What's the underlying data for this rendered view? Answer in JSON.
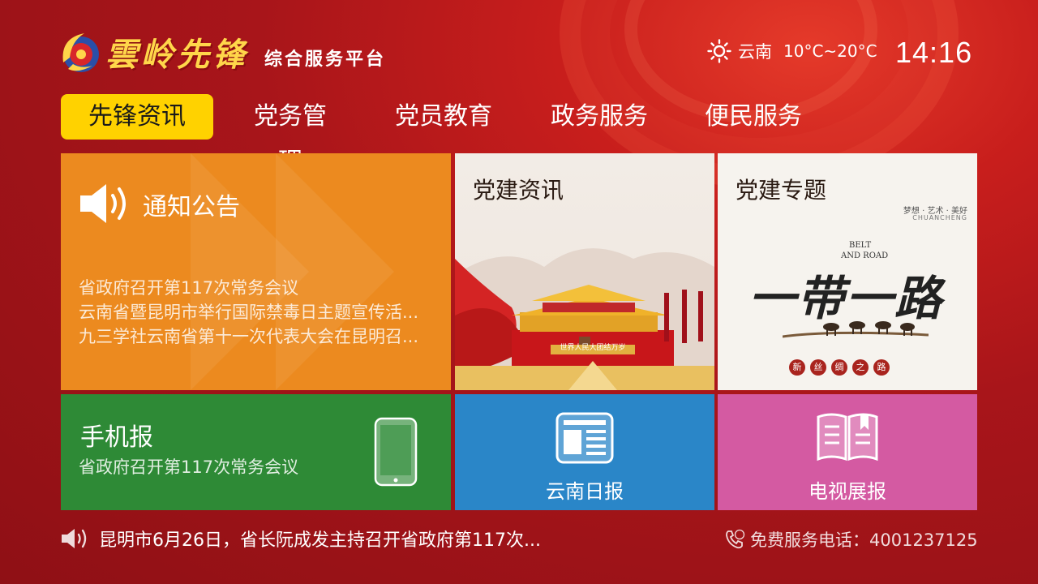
{
  "header": {
    "logo_title": "雲岭先锋",
    "logo_subtitle": "综合服务平台",
    "weather_icon": "sun-icon",
    "location": "云南",
    "temperature": "10°C~20°C",
    "time": "14:16"
  },
  "nav": {
    "tabs": [
      {
        "label": "先锋资讯",
        "active": true
      },
      {
        "label": "党务管理",
        "active": false
      },
      {
        "label": "党员教育",
        "active": false
      },
      {
        "label": "政务服务",
        "active": false
      },
      {
        "label": "便民服务",
        "active": false
      }
    ]
  },
  "tiles": {
    "notice": {
      "title": "通知公告",
      "icon": "speaker-icon",
      "items": [
        "省政府召开第117次常务会议",
        "云南省暨昆明市举行国际禁毒日主题宣传活...",
        "九三学社云南省第十一次代表大会在昆明召..."
      ]
    },
    "party_news": {
      "title": "党建资讯",
      "banner_text": "世界人民大团结万岁"
    },
    "party_topic": {
      "title": "党建专题",
      "tagline": "梦想 · 艺术 · 美好",
      "tagline_en": "CHUANCHENG",
      "belt_road_en_1": "BELT",
      "belt_road_en_2": "AND ROAD",
      "calligraphy": "一带一路",
      "seal_chars": [
        "新",
        "丝",
        "绸",
        "之",
        "路"
      ]
    },
    "phone": {
      "title": "手机报",
      "subtitle": "省政府召开第117次常务会议",
      "icon": "phone-icon"
    },
    "daily": {
      "label": "云南日报",
      "icon": "newspaper-icon"
    },
    "tv": {
      "label": "电视展报",
      "icon": "book-icon"
    }
  },
  "footer": {
    "ticker_text": "昆明市6月26日，省长阮成发主持召开省政府第117次...",
    "hotline": "免费服务电话：4001237125"
  },
  "colors": {
    "accent_yellow": "#ffd200",
    "notice_orange": "#ec8a1f",
    "phone_green": "#2e8a36",
    "daily_blue": "#2a86c8",
    "tv_pink": "#d45aa2"
  }
}
